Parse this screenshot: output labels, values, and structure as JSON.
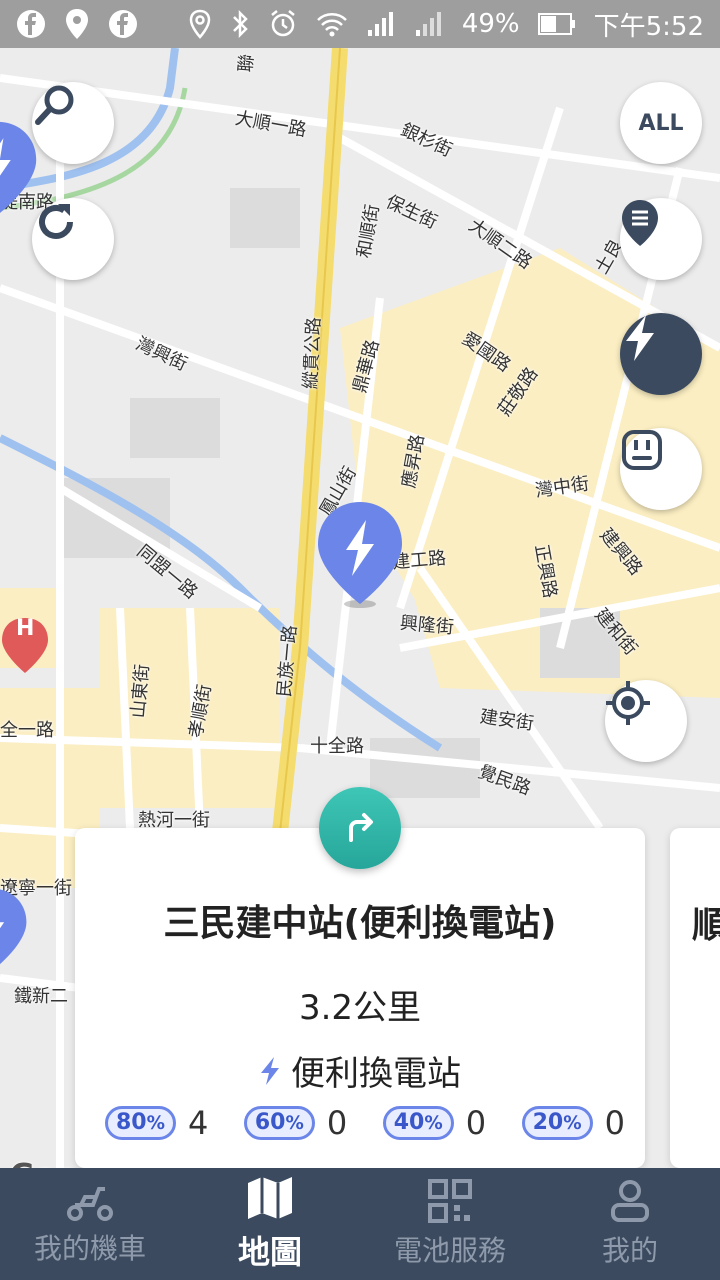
{
  "status_bar": {
    "battery": "49%",
    "time": "下午5:52"
  },
  "map": {
    "streets": [
      "大順一路",
      "銀杉街",
      "保生街",
      "大順二路",
      "和順街",
      "土良",
      "灣興街",
      "鼎華路",
      "愛國路",
      "莊敬路",
      "縱貫公路",
      "鳳山街",
      "應昇路",
      "灣中街",
      "建興路",
      "同盟一路",
      "建工路",
      "正興路",
      "興隆街",
      "建和街",
      "民族一路",
      "山東街",
      "孝順街",
      "建安街",
      "十全路",
      "覺民路",
      "熱河一街",
      "遼寧一街",
      "鐵新二",
      "全一路",
      "堤南路",
      "聯"
    ],
    "hospital_label": "H",
    "google_label": "Goo"
  },
  "controls": {
    "all_label": "ALL"
  },
  "card": {
    "title": "三民建中站(便利換電站)",
    "distance": "3.2公里",
    "type": "便利換電站",
    "batteries": [
      {
        "level": "80",
        "unit": "%",
        "count": "4"
      },
      {
        "level": "60",
        "unit": "%",
        "count": "0"
      },
      {
        "level": "40",
        "unit": "%",
        "count": "0"
      },
      {
        "level": "20",
        "unit": "%",
        "count": "0"
      }
    ],
    "peek_title": "順"
  },
  "nav": {
    "items": [
      {
        "label": "我的機車"
      },
      {
        "label": "地圖"
      },
      {
        "label": "電池服務"
      },
      {
        "label": "我的"
      }
    ]
  },
  "colors": {
    "accent": "#3b4a5e",
    "teal": "#26a69a",
    "pin": "#6b86e8",
    "road_main": "#f5dc6e",
    "block": "#fbeec2"
  }
}
